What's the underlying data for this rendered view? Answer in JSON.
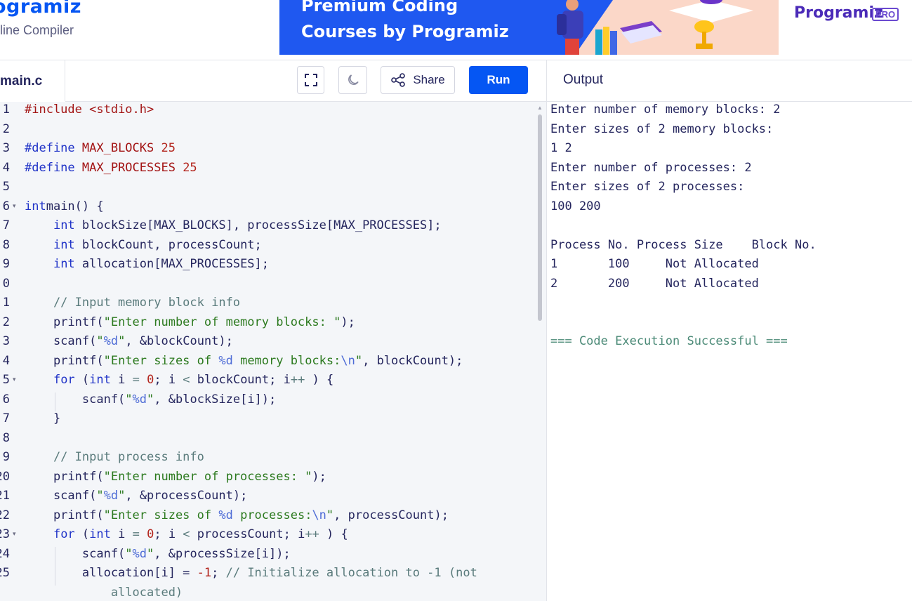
{
  "header": {
    "logo": "ogramiz",
    "subtitle": "nline Compiler",
    "banner_line1": "Premium Coding",
    "banner_line2": "Courses by Programiz",
    "promo_text": "Programiz",
    "promo_badge": "PRO"
  },
  "toolbar": {
    "file_tab": "main.c",
    "share_label": "Share",
    "run_label": "Run",
    "output_label": "Output"
  },
  "editor": {
    "line_numbers": [
      "1",
      "2",
      "3",
      "4",
      "5",
      "6",
      "7",
      "8",
      "9",
      "0",
      "1",
      "2",
      "3",
      "4",
      "5",
      "6",
      "7",
      "8",
      "9",
      "20",
      "21",
      "22",
      "23",
      "24",
      "25"
    ],
    "fold_lines": [
      6,
      15,
      23
    ],
    "lines": [
      [
        [
          "mac",
          "#include "
        ],
        [
          "mac",
          "<stdio.h>"
        ]
      ],
      [],
      [
        [
          "kw",
          "#define "
        ],
        [
          "mac",
          "MAX_BLOCKS "
        ],
        [
          "num",
          "25"
        ]
      ],
      [
        [
          "kw",
          "#define "
        ],
        [
          "mac",
          "MAX_PROCESSES "
        ],
        [
          "num",
          "25"
        ]
      ],
      [],
      [
        [
          "kw",
          "int"
        ],
        [
          "",
          "main() {"
        ]
      ],
      [
        [
          "",
          "    "
        ],
        [
          "kw",
          "int"
        ],
        [
          "",
          " blockSize[MAX_BLOCKS], processSize[MAX_PROCESSES];"
        ]
      ],
      [
        [
          "",
          "    "
        ],
        [
          "kw",
          "int"
        ],
        [
          "",
          " blockCount, processCount;"
        ]
      ],
      [
        [
          "",
          "    "
        ],
        [
          "kw",
          "int"
        ],
        [
          "",
          " allocation[MAX_PROCESSES];"
        ]
      ],
      [],
      [
        [
          "cm",
          "    // Input memory block info"
        ]
      ],
      [
        [
          "",
          "    printf("
        ],
        [
          "str",
          "\"Enter number of memory blocks: \""
        ],
        [
          "",
          ");"
        ]
      ],
      [
        [
          "",
          "    scanf("
        ],
        [
          "str",
          "\""
        ],
        [
          "fmt",
          "%d"
        ],
        [
          "str",
          "\""
        ],
        [
          "",
          ", &blockCount);"
        ]
      ],
      [
        [
          "",
          "    printf("
        ],
        [
          "str",
          "\"Enter sizes of "
        ],
        [
          "fmt",
          "%d"
        ],
        [
          "str",
          " memory blocks:"
        ],
        [
          "fmt",
          "\\n"
        ],
        [
          "str",
          "\""
        ],
        [
          "",
          ", blockCount);"
        ]
      ],
      [
        [
          "",
          "    "
        ],
        [
          "kw",
          "for"
        ],
        [
          "",
          " ("
        ],
        [
          "kw",
          "int"
        ],
        [
          "",
          " i "
        ],
        [
          "cm",
          "="
        ],
        [
          "",
          " "
        ],
        [
          "num",
          "0"
        ],
        [
          "",
          "; i "
        ],
        [
          "cm",
          "<"
        ],
        [
          "",
          " blockCount; i"
        ],
        [
          "cm",
          "++"
        ],
        [
          "",
          " ) {"
        ]
      ],
      [
        [
          "",
          "        scanf("
        ],
        [
          "str",
          "\""
        ],
        [
          "fmt",
          "%d"
        ],
        [
          "str",
          "\""
        ],
        [
          "",
          ", &blockSize[i]);"
        ]
      ],
      [
        [
          "",
          "    }"
        ]
      ],
      [],
      [
        [
          "cm",
          "    // Input process info"
        ]
      ],
      [
        [
          "",
          "    printf("
        ],
        [
          "str",
          "\"Enter number of processes: \""
        ],
        [
          "",
          ");"
        ]
      ],
      [
        [
          "",
          "    scanf("
        ],
        [
          "str",
          "\""
        ],
        [
          "fmt",
          "%d"
        ],
        [
          "str",
          "\""
        ],
        [
          "",
          ", &processCount);"
        ]
      ],
      [
        [
          "",
          "    printf("
        ],
        [
          "str",
          "\"Enter sizes of "
        ],
        [
          "fmt",
          "%d"
        ],
        [
          "str",
          " processes:"
        ],
        [
          "fmt",
          "\\n"
        ],
        [
          "str",
          "\""
        ],
        [
          "",
          ", processCount);"
        ]
      ],
      [
        [
          "",
          "    "
        ],
        [
          "kw",
          "for"
        ],
        [
          "",
          " ("
        ],
        [
          "kw",
          "int"
        ],
        [
          "",
          " i "
        ],
        [
          "cm",
          "="
        ],
        [
          "",
          " "
        ],
        [
          "num",
          "0"
        ],
        [
          "",
          "; i "
        ],
        [
          "cm",
          "<"
        ],
        [
          "",
          " processCount; i"
        ],
        [
          "cm",
          "++"
        ],
        [
          "",
          " ) {"
        ]
      ],
      [
        [
          "",
          "        scanf("
        ],
        [
          "str",
          "\""
        ],
        [
          "fmt",
          "%d"
        ],
        [
          "str",
          "\""
        ],
        [
          "",
          ", &processSize[i]);"
        ]
      ],
      [
        [
          "",
          "        allocation[i] = "
        ],
        [
          "num",
          "-1"
        ],
        [
          "",
          "; "
        ],
        [
          "cm",
          "// Initialize allocation to -1 (not"
        ]
      ],
      [
        [
          "cm",
          "            allocated)"
        ]
      ]
    ]
  },
  "output": {
    "lines": [
      "Enter number of memory blocks: 2",
      "Enter sizes of 2 memory blocks:",
      "1 2",
      "Enter number of processes: 2",
      "Enter sizes of 2 processes:",
      "100 200",
      "",
      "Process No. Process Size    Block No.",
      "1       100     Not Allocated",
      "2       200     Not Allocated",
      "",
      "",
      "=== Code Execution Successful ==="
    ],
    "success_line_index": 12
  },
  "colors": {
    "brand": "#0556f3",
    "editor_bg": "#f4f6f9",
    "keyword": "#2134c8",
    "string": "#2c7a1f",
    "number": "#b3261e",
    "comment": "#5a7b7c",
    "success": "#4b8a77"
  },
  "icons": [
    "fullscreen-icon",
    "moon-icon",
    "share-icon"
  ]
}
